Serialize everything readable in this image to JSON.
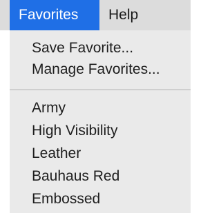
{
  "menubar": {
    "items": [
      {
        "label": "Favorites",
        "active": true
      },
      {
        "label": "Help",
        "active": false
      }
    ]
  },
  "dropdown": {
    "group1": [
      {
        "label": "Save Favorite..."
      },
      {
        "label": "Manage Favorites..."
      }
    ],
    "group2": [
      {
        "label": "Army"
      },
      {
        "label": "High Visibility"
      },
      {
        "label": "Leather"
      },
      {
        "label": "Bauhaus Red"
      },
      {
        "label": "Embossed"
      }
    ]
  },
  "colors": {
    "menubar_bg": "#dcdcdc",
    "active_highlight": "#1f6fe6",
    "dropdown_bg": "#eaeaea",
    "separator": "#cfcfcf",
    "text": "#1e1e1e"
  }
}
